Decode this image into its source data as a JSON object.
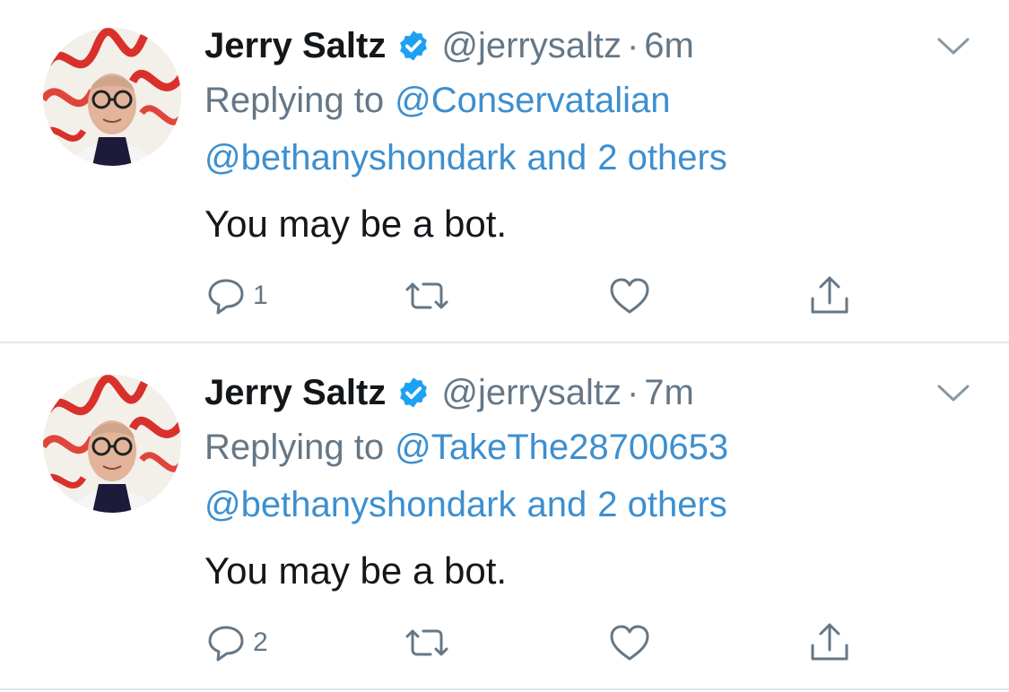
{
  "tweets": [
    {
      "author": {
        "name": "Jerry Saltz",
        "handle": "@jerrysaltz",
        "verified": true
      },
      "separator": "·",
      "time": "6m",
      "replying_prefix": "Replying to",
      "replying_to_first": "@Conservatalian",
      "replying_to_second": "@bethanyshondark",
      "replying_and": "and",
      "replying_others": "2 others",
      "text": "You may be a bot.",
      "reply_count": "1"
    },
    {
      "author": {
        "name": "Jerry Saltz",
        "handle": "@jerrysaltz",
        "verified": true
      },
      "separator": "·",
      "time": "7m",
      "replying_prefix": "Replying to",
      "replying_to_first": "@TakeThe28700653",
      "replying_to_second": "@bethanyshondark",
      "replying_and": "and",
      "replying_others": "2 others",
      "text": "You may be a bot.",
      "reply_count": "2"
    }
  ],
  "icons": {
    "verified": "verified-badge-icon",
    "menu": "chevron-down-icon",
    "reply": "reply-bubble-icon",
    "retweet": "retweet-icon",
    "like": "heart-icon",
    "share": "share-icon"
  },
  "colors": {
    "link": "#3d8fcf",
    "secondary": "#657786",
    "verified": "#1da1f2",
    "divider": "#e1e8ed"
  }
}
